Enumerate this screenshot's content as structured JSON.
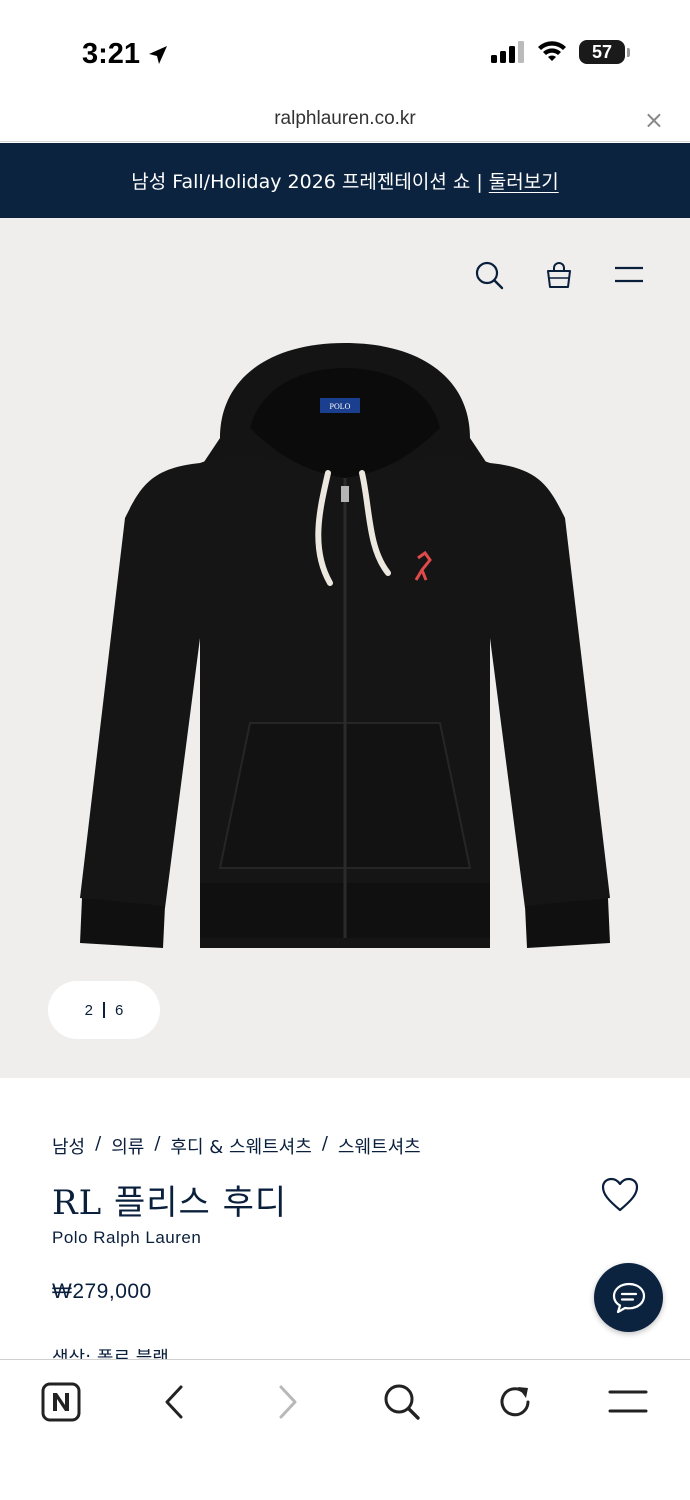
{
  "status_bar": {
    "time": "3:21",
    "battery": "57",
    "battery_level": 0.57
  },
  "url_bar": {
    "url": "ralphlauren.co.kr",
    "close_symbol": "×"
  },
  "promo": {
    "text": "남성 Fall/Holiday 2026 프레젠테이션 쇼 |",
    "link_text": "둘러보기"
  },
  "header": {
    "icons": [
      "search-icon",
      "shopping-bag-icon",
      "menu-icon"
    ]
  },
  "gallery": {
    "current": "2",
    "total": "6"
  },
  "breadcrumb": [
    "남성",
    "의류",
    "후디 & 스웨트셔츠",
    "스웨트셔츠"
  ],
  "breadcrumb_separator": "/",
  "product": {
    "title": "RL 플리스 후디",
    "brand": "Polo Ralph Lauren",
    "price": "₩279,000",
    "color_line": "색상: 폴로 블랙"
  },
  "colors": {
    "navy": "#0c2340",
    "hero_bg": "#efeeed",
    "pony_red": "#e04a4a"
  },
  "toolbar": {
    "icons": [
      "naver-home-icon",
      "back-icon",
      "forward-icon",
      "search-icon",
      "reload-icon",
      "menu-icon"
    ]
  }
}
